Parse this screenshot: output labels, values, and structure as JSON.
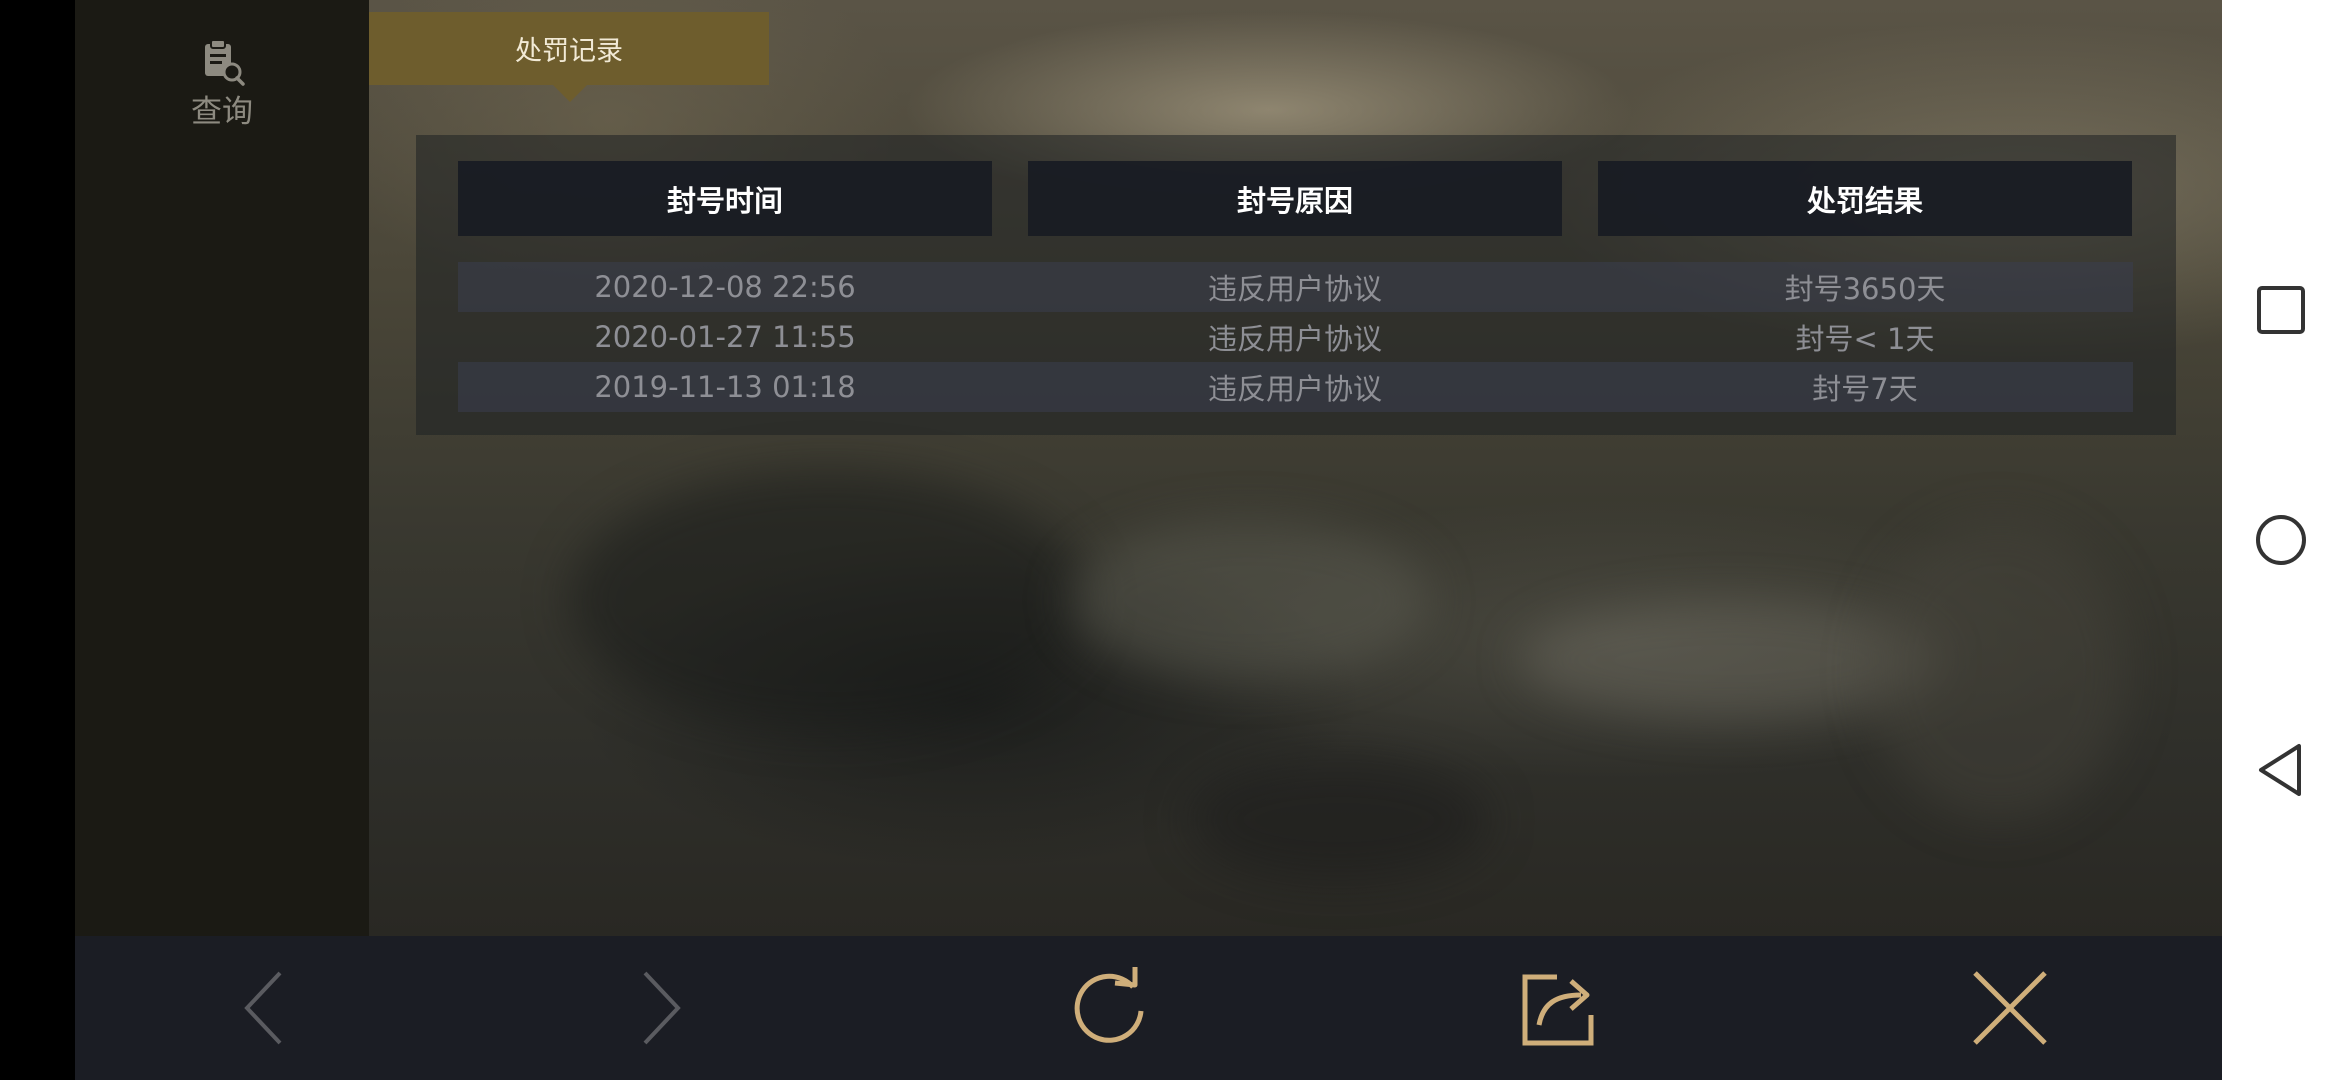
{
  "sidebar": {
    "query_label": "查询",
    "query_icon": "clipboard-search-icon"
  },
  "tab": {
    "label": "处罚记录",
    "active_color": "#6e5d2d"
  },
  "table": {
    "headers": [
      "封号时间",
      "封号原因",
      "处罚结果"
    ],
    "rows": [
      [
        "2020-12-08 22:56",
        "违反用户协议",
        "封号3650天"
      ],
      [
        "2020-01-27 11:55",
        "违反用户协议",
        "封号< 1天"
      ],
      [
        "2019-11-13 01:18",
        "违反用户协议",
        "封号7天"
      ]
    ]
  },
  "bottom_bar": {
    "icons": [
      "back-arrow-icon",
      "forward-arrow-icon",
      "refresh-icon",
      "share-icon",
      "close-icon"
    ],
    "icon_color": "#cfae7a"
  },
  "android_nav": {
    "icons": [
      "recent-apps-icon",
      "home-icon",
      "back-icon"
    ]
  }
}
